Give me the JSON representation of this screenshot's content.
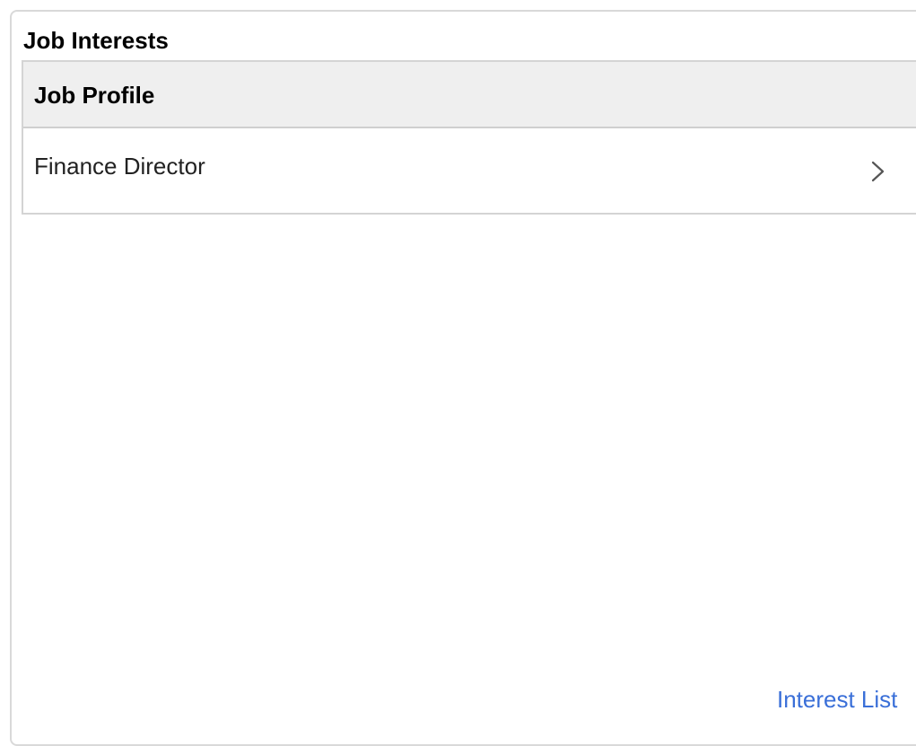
{
  "panel": {
    "title": "Job Interests"
  },
  "table": {
    "header": "Job Profile",
    "rows": [
      {
        "label": "Finance Director"
      }
    ]
  },
  "links": {
    "interest_list": "Interest List"
  },
  "icons": {
    "row_chevron": "chevron-right-icon"
  },
  "colors": {
    "link": "#3a6fd8",
    "header_bg": "#efefef",
    "border": "#d4d4d4"
  }
}
